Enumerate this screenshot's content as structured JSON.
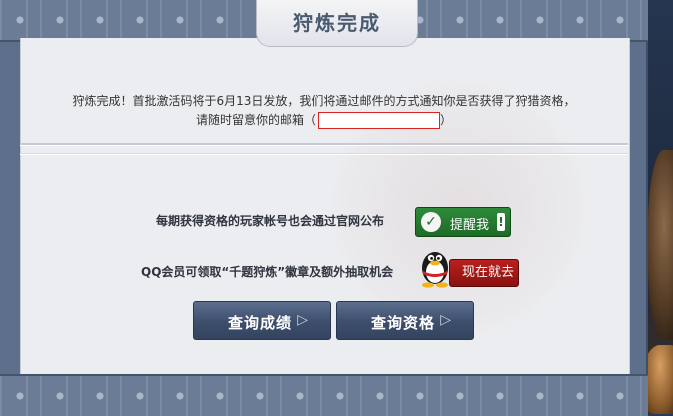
{
  "title": "狩炼完成",
  "notice": {
    "line1": "狩炼完成！首批激活码将于6月13日发放，我们将通过邮件的方式通知你是否获得了狩猎资格，",
    "line2_prefix": "请随时留意你的邮箱（",
    "line2_suffix": "）"
  },
  "row1": {
    "text": "每期获得资格的玩家帐号也会通过官网公布",
    "button_label": "提醒我",
    "check_glyph": "✓",
    "excl_glyph": "!"
  },
  "row2": {
    "text": "QQ会员可领取“千题狩炼”徽章及额外抽取机会",
    "button_label": "现在就去"
  },
  "query_buttons": [
    {
      "label": "查询成绩",
      "arrow": "▷"
    },
    {
      "label": "查询资格",
      "arrow": "▷"
    }
  ],
  "icons": {
    "check": "check-icon",
    "exclamation": "exclamation-icon",
    "qq": "qq-penguin-icon",
    "arrow": "arrow-right-icon"
  },
  "colors": {
    "frame": "#5d6f8a",
    "content_bg": "#ecedf0",
    "remind_green": "#2e8b3a",
    "go_red": "#b8201e",
    "query_blue": "#3d4e6c",
    "email_border": "#dd2222"
  }
}
